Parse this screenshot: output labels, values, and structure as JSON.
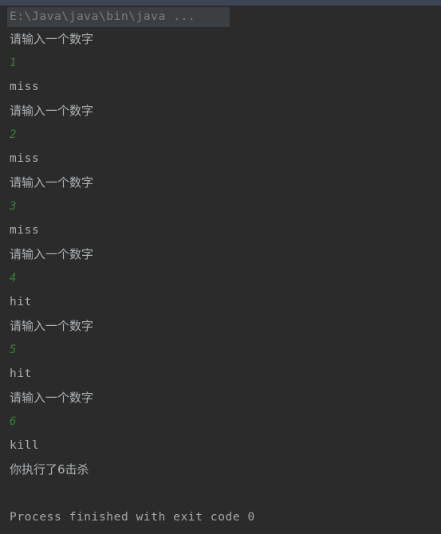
{
  "window": {
    "title_strip_color": "#3c4455",
    "background_color": "#2b2b2b"
  },
  "console": {
    "command_line": "E:\\Java\\java\\bin\\java ...",
    "colors": {
      "stdout": "#a9adb0",
      "stdin_echo": "#2a8a2a",
      "command": "#7b7b7b",
      "highlight_background": "#3c3f41"
    },
    "lines": [
      {
        "text": "请输入一个数字",
        "kind": "cjk"
      },
      {
        "text": "1",
        "kind": "input"
      },
      {
        "text": "miss",
        "kind": "stdout"
      },
      {
        "text": "请输入一个数字",
        "kind": "cjk"
      },
      {
        "text": "2",
        "kind": "input"
      },
      {
        "text": "miss",
        "kind": "stdout"
      },
      {
        "text": "请输入一个数字",
        "kind": "cjk"
      },
      {
        "text": "3",
        "kind": "input"
      },
      {
        "text": "miss",
        "kind": "stdout"
      },
      {
        "text": "请输入一个数字",
        "kind": "cjk"
      },
      {
        "text": "4",
        "kind": "input"
      },
      {
        "text": "hit",
        "kind": "stdout"
      },
      {
        "text": "请输入一个数字",
        "kind": "cjk"
      },
      {
        "text": "5",
        "kind": "input"
      },
      {
        "text": "hit",
        "kind": "stdout"
      },
      {
        "text": "请输入一个数字",
        "kind": "cjk"
      },
      {
        "text": "6",
        "kind": "input"
      },
      {
        "text": "kill",
        "kind": "stdout"
      },
      {
        "text": "你执行了6击杀",
        "kind": "cjk"
      },
      {
        "text": " ",
        "kind": "blank"
      },
      {
        "text": "Process finished with exit code 0",
        "kind": "exit"
      }
    ]
  }
}
